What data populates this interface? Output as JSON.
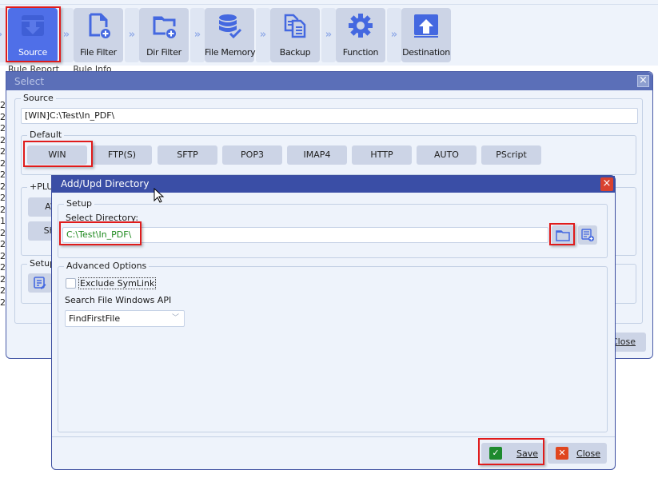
{
  "toolbar": {
    "items": [
      {
        "label": "Source",
        "icon": "download-tray-icon",
        "active": true
      },
      {
        "label": "File Filter",
        "icon": "file-add-icon",
        "active": false
      },
      {
        "label": "Dir Filter",
        "icon": "folder-add-icon",
        "active": false
      },
      {
        "label": "File Memory",
        "icon": "database-check-icon",
        "active": false
      },
      {
        "label": "Backup",
        "icon": "copy-documents-icon",
        "active": false
      },
      {
        "label": "Function",
        "icon": "gear-icon",
        "active": false
      },
      {
        "label": "Destination",
        "icon": "upload-tray-icon",
        "active": false
      }
    ],
    "separator_glyph": "»"
  },
  "background": {
    "tabs": [
      "Rule Report",
      "Rule Info"
    ],
    "row_digits": [
      "2",
      "2",
      "2",
      "2",
      "2",
      "2",
      "2",
      "2",
      "2",
      "2",
      "1",
      "2",
      "2",
      "2",
      "2",
      "2",
      "2",
      "2"
    ]
  },
  "select_window": {
    "title": "Select",
    "source_group": "Source",
    "source_value": "[WIN]C:\\Test\\In_PDF\\",
    "default_group": "Default",
    "protocols": [
      "WIN",
      "FTP(S)",
      "SFTP",
      "POP3",
      "IMAP4",
      "HTTP",
      "AUTO",
      "PScript"
    ],
    "plus_group": "+PLUS",
    "plus_buttons": [
      "AW",
      "Sha"
    ],
    "setup_group": "Setup",
    "close_label": "Close"
  },
  "add_dialog": {
    "title": "Add/Upd Directory",
    "setup_group": "Setup",
    "select_directory_label": "Select Directory:",
    "directory_value": "C:\\Test\\In_PDF\\",
    "advanced_group": "Advanced  Options",
    "exclude_symlink_label": "Exclude SymLink",
    "exclude_symlink_checked": false,
    "search_api_label": "Search File Windows API",
    "search_api_value": "FindFirstFile",
    "save_label": "Save",
    "close_label": "Close"
  },
  "colors": {
    "accent": "#4f6fe8",
    "highlight": "#e01b1b",
    "title_active": "#3a4ea6",
    "title_inactive": "#5b6fb8",
    "path_text": "#1e8a1e",
    "save_icon": "#1e8a2e",
    "close_icon": "#e0461e"
  }
}
